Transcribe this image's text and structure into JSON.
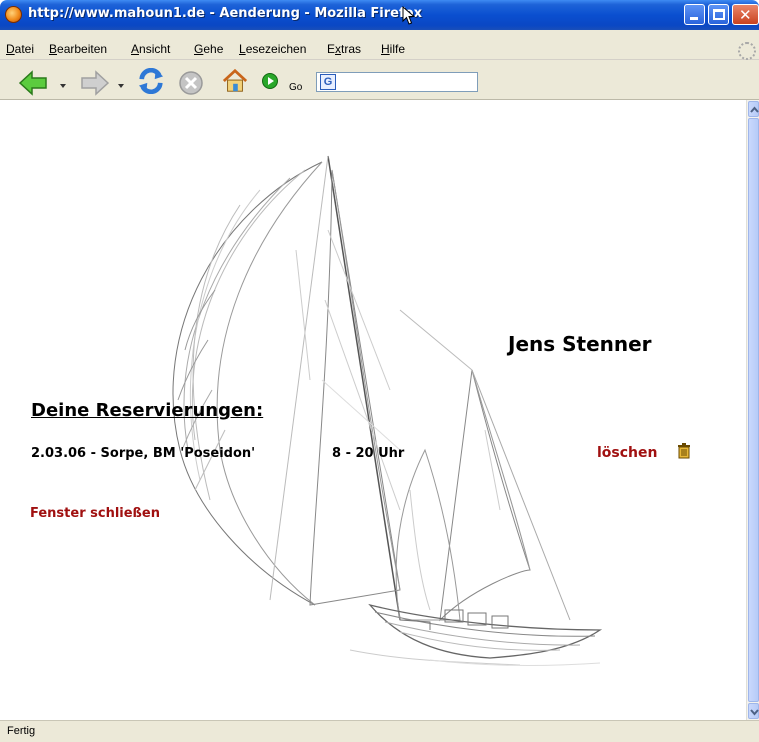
{
  "window": {
    "title": "http://www.mahoun1.de - Aenderung - Mozilla Firefox"
  },
  "menu": {
    "items": [
      {
        "underline": "D",
        "rest": "atei"
      },
      {
        "underline": "B",
        "rest": "earbeiten"
      },
      {
        "underline": "A",
        "rest": "nsicht"
      },
      {
        "underline": "G",
        "rest": "ehe"
      },
      {
        "underline": "L",
        "rest": "esezeichen"
      },
      {
        "pre": "E",
        "underline": "x",
        "rest": "tras"
      },
      {
        "underline": "H",
        "rest": "ilfe"
      }
    ]
  },
  "toolbar": {
    "go_label": "Go",
    "search_logo": "G"
  },
  "page": {
    "name": "Jens Stenner",
    "heading": "Deine Reservierungen:",
    "reservations": [
      {
        "entry": "2.03.06 - Sorpe, BM 'Poseidon'",
        "time": "8 - 20 Uhr",
        "delete_label": "löschen"
      }
    ],
    "close_window_label": "Fenster schließen"
  },
  "status": {
    "text": "Fertig"
  },
  "colors": {
    "link": "#a01010",
    "titlebar": "#0a4fd0",
    "chrome": "#ece9d8"
  },
  "icons": [
    "firefox-icon",
    "back-icon",
    "forward-icon",
    "reload-icon",
    "stop-icon",
    "home-icon",
    "go-icon",
    "google-search-icon",
    "trash-icon",
    "mouse-pointer-icon"
  ]
}
